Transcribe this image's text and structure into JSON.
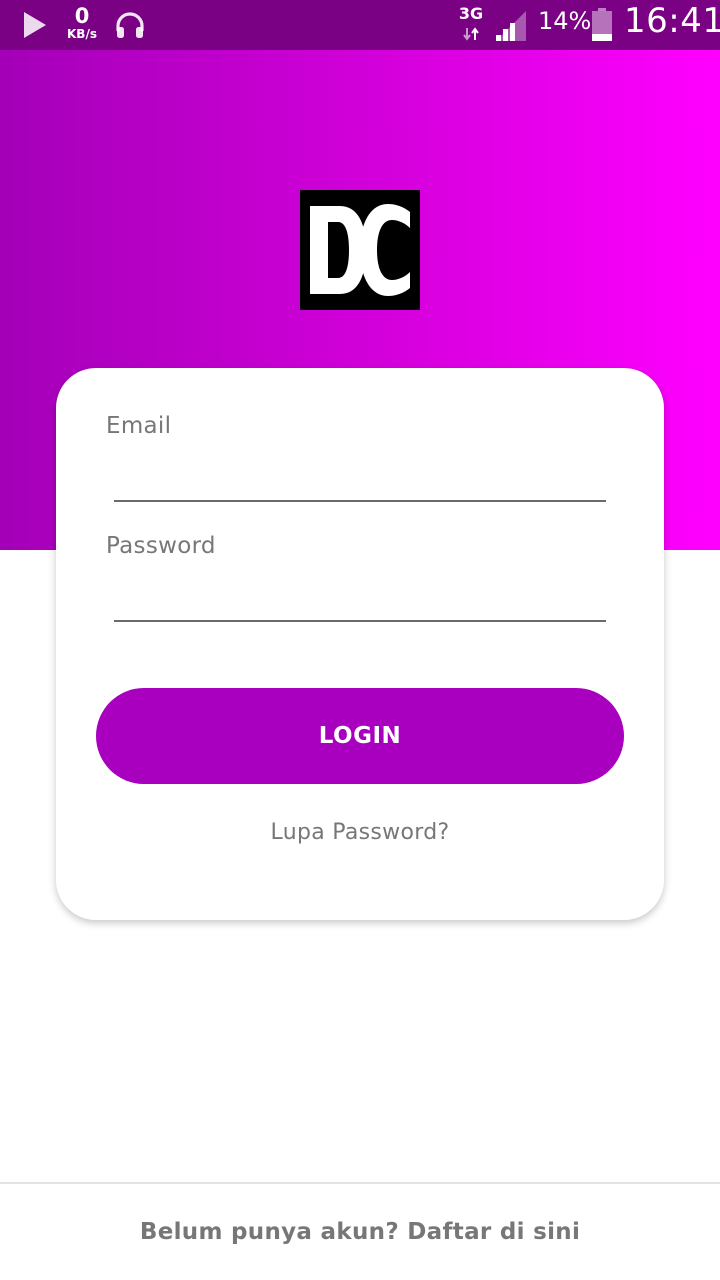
{
  "status_bar": {
    "speed_value": "0",
    "speed_unit": "KB/s",
    "network_type": "3G",
    "battery_percent": "14%",
    "clock": "16:41",
    "icons": [
      "play-icon",
      "headphones-icon",
      "data-arrows-icon",
      "signal-icon",
      "battery-icon"
    ]
  },
  "header": {
    "logo_icon": "dc-logo-icon",
    "gradient_start": "#a400b8",
    "gradient_end": "#ff00ff"
  },
  "login_form": {
    "email_label": "Email",
    "email_value": "",
    "password_label": "Password",
    "password_value": "",
    "login_button_label": "LOGIN",
    "forgot_password_label": "Lupa Password?"
  },
  "footer": {
    "register_label": "Belum punya akun? Daftar di sini"
  },
  "colors": {
    "status_bar": "#7a0084",
    "accent": "#a800be",
    "text_muted": "#777777"
  }
}
